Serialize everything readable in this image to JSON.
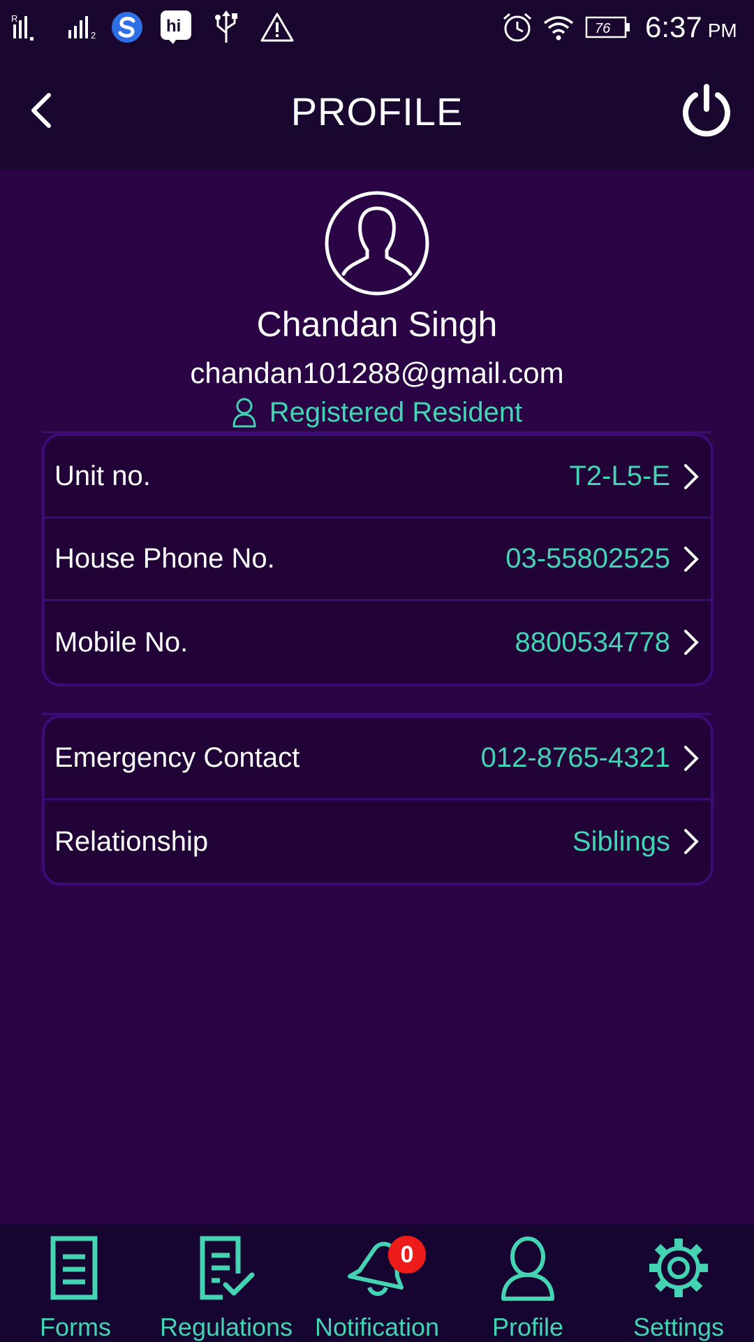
{
  "status_bar": {
    "time": "6:37",
    "ampm": "PM",
    "battery": "76",
    "icons": [
      "signal-r-icon",
      "signal-2-icon",
      "s-app-icon",
      "hi-app-icon",
      "usb-icon",
      "warning-icon",
      "alarm-icon",
      "wifi-icon",
      "battery-icon"
    ]
  },
  "header": {
    "title": "PROFILE",
    "back_icon": "chevron-left-icon",
    "logout_icon": "power-icon"
  },
  "profile": {
    "name": "Chandan Singh",
    "email": "chandan101288@gmail.com",
    "role": "Registered Resident"
  },
  "details": [
    {
      "label": "Unit no.",
      "value": "T2-L5-E"
    },
    {
      "label": "House Phone No.",
      "value": "03-55802525"
    },
    {
      "label": "Mobile No.",
      "value": "8800534778"
    }
  ],
  "emergency": [
    {
      "label": "Emergency Contact",
      "value": "012-8765-4321"
    },
    {
      "label": "Relationship",
      "value": "Siblings"
    }
  ],
  "nav": [
    {
      "label": "Forms",
      "icon": "forms-icon"
    },
    {
      "label": "Regulations",
      "icon": "regulations-icon"
    },
    {
      "label": "Notification",
      "icon": "bell-icon",
      "badge": "0"
    },
    {
      "label": "Profile",
      "icon": "profile-icon"
    },
    {
      "label": "Settings",
      "icon": "gear-icon"
    }
  ],
  "colors": {
    "background": "#2a0445",
    "bar": "#190730",
    "accent": "#45d4b3",
    "border": "#3c0b75",
    "badge": "#ee1b1b"
  }
}
